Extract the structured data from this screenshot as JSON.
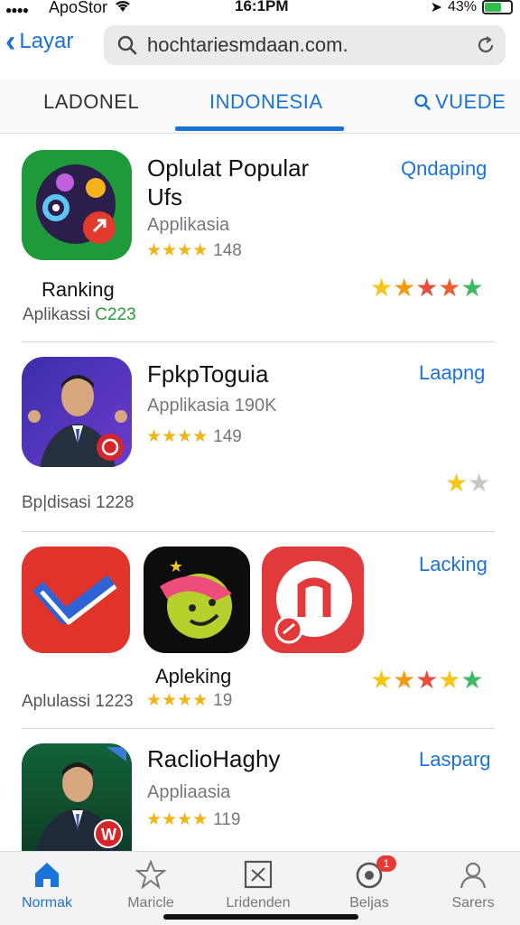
{
  "status": {
    "carrier": "ApoStor",
    "time": "16:1PM",
    "battery": "43%"
  },
  "nav": {
    "back_label": "Layar",
    "url_value": "hochtariesmdaan.com."
  },
  "tabs": [
    {
      "label": "LADONEL"
    },
    {
      "label": "INDONESIA"
    },
    {
      "label": "VUEDE"
    }
  ],
  "apps": [
    {
      "title_line1": "Oplulat Popular",
      "title_line2": "Ufs",
      "category": "Applikasia",
      "stars": "★★★★",
      "rating_count": "148",
      "action": "Qndaping",
      "extra_label": "Ranking",
      "extra_sub": "Aplikassi",
      "extra_count": "C223"
    },
    {
      "title": "FpkpToguia",
      "category": "Applikasia 190K",
      "stars": "★★★★",
      "rating_count": "149",
      "action": "Laapng",
      "green_label": "Bp|disasi 1228"
    },
    {
      "label": "Apleking",
      "green_label": "Aplulassi 1223",
      "stars": "★★★★",
      "rating_count": "19",
      "action": "Lacking"
    },
    {
      "title": "RaclioHaghy",
      "category": "Appliaasia",
      "stars": "★★★★",
      "rating_count": "119",
      "action": "Lasparg"
    }
  ],
  "tabbar": [
    {
      "label": "Normak",
      "icon": "home-icon"
    },
    {
      "label": "Maricle",
      "icon": "star-icon"
    },
    {
      "label": "Lridenden",
      "icon": "checkbox-icon"
    },
    {
      "label": "Beljas",
      "icon": "updates-icon",
      "badge": "1"
    },
    {
      "label": "Sarers",
      "icon": "person-icon"
    }
  ],
  "colors": {
    "accent": "#1a73d9",
    "star": "#f1b416",
    "green_text": "#2b9a3e"
  }
}
